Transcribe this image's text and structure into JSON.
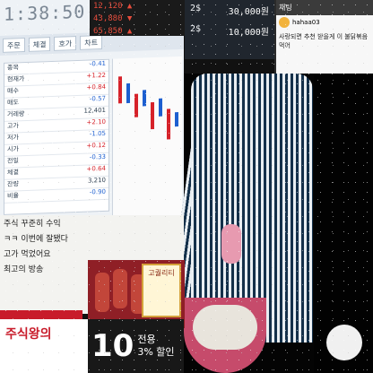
{
  "trading_panel": {
    "clock": "1:38:50",
    "tabs": [
      "주문",
      "체결",
      "호가",
      "차트"
    ],
    "rows": [
      {
        "label": "종목",
        "value": "-0.41",
        "kind": "neg"
      },
      {
        "label": "현재가",
        "value": "+1.22",
        "kind": "pos"
      },
      {
        "label": "매수",
        "value": "+0.84",
        "kind": "pos"
      },
      {
        "label": "매도",
        "value": "-0.57",
        "kind": "neg"
      },
      {
        "label": "거래량",
        "value": "12,401",
        "kind": ""
      },
      {
        "label": "고가",
        "value": "+2.10",
        "kind": "pos"
      },
      {
        "label": "저가",
        "value": "-1.05",
        "kind": "neg"
      },
      {
        "label": "시가",
        "value": "+0.12",
        "kind": "pos"
      },
      {
        "label": "전일",
        "value": "-0.33",
        "kind": "neg"
      },
      {
        "label": "체결",
        "value": "+0.64",
        "kind": "pos"
      },
      {
        "label": "잔량",
        "value": "3,210",
        "kind": ""
      },
      {
        "label": "비율",
        "value": "-0.90",
        "kind": "neg"
      }
    ]
  },
  "price_bar": {
    "lines": [
      "12,120 ▲",
      "43,880 ▼",
      "65,850 ▲"
    ]
  },
  "order_bar": {
    "lines": [
      {
        "left": "2$",
        "right": "30,000원"
      },
      {
        "left": "2$",
        "right": "10,000원"
      }
    ]
  },
  "chat": {
    "header": "채팅",
    "user": "hahaa03",
    "message": "사랑되면 추천 받을게 이 불닭볶음 먹어"
  },
  "lower": {
    "chat_lines": [
      "주식 꾸준히 수익",
      "ㅋㅋ 이번에 잘됐다",
      "고가 먹었어요",
      "최고의 방송"
    ]
  },
  "food_ad": {
    "badge": "고퀄리티"
  },
  "ads": {
    "left": "주식왕의",
    "number": "10",
    "pct_line1": "전용",
    "pct_line2": "3% 할인"
  }
}
